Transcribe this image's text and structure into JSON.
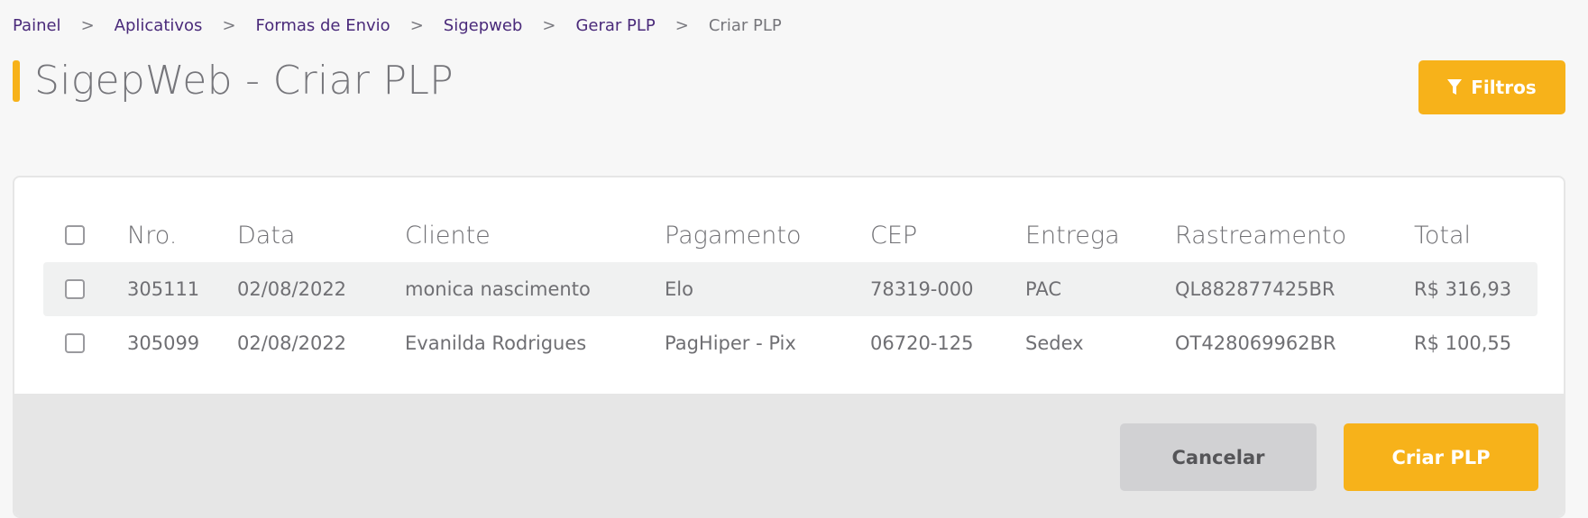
{
  "breadcrumb": {
    "items": [
      "Painel",
      "Aplicativos",
      "Formas de Envio",
      "Sigepweb",
      "Gerar PLP"
    ],
    "current": "Criar PLP",
    "separator": ">"
  },
  "page": {
    "title": "SigepWeb - Criar PLP"
  },
  "toolbar": {
    "filters_label": "Filtros",
    "filters_icon": "filter-icon"
  },
  "table": {
    "headers": [
      "Nro.",
      "Data",
      "Cliente",
      "Pagamento",
      "CEP",
      "Entrega",
      "Rastreamento",
      "Total"
    ],
    "rows": [
      {
        "nro": "305111",
        "data": "02/08/2022",
        "cliente": "monica nascimento",
        "pagamento": "Elo",
        "cep": "78319-000",
        "entrega": "PAC",
        "rastreamento": "QL882877425BR",
        "total": "R$ 316,93"
      },
      {
        "nro": "305099",
        "data": "02/08/2022",
        "cliente": "Evanilda Rodrigues",
        "pagamento": "PagHiper - Pix",
        "cep": "06720-125",
        "entrega": "Sedex",
        "rastreamento": "OT428069962BR",
        "total": "R$ 100,55"
      }
    ]
  },
  "actions": {
    "cancel_label": "Cancelar",
    "create_label": "Criar PLP"
  },
  "colors": {
    "accent": "#f7b21a",
    "link": "#4a2a7a"
  }
}
